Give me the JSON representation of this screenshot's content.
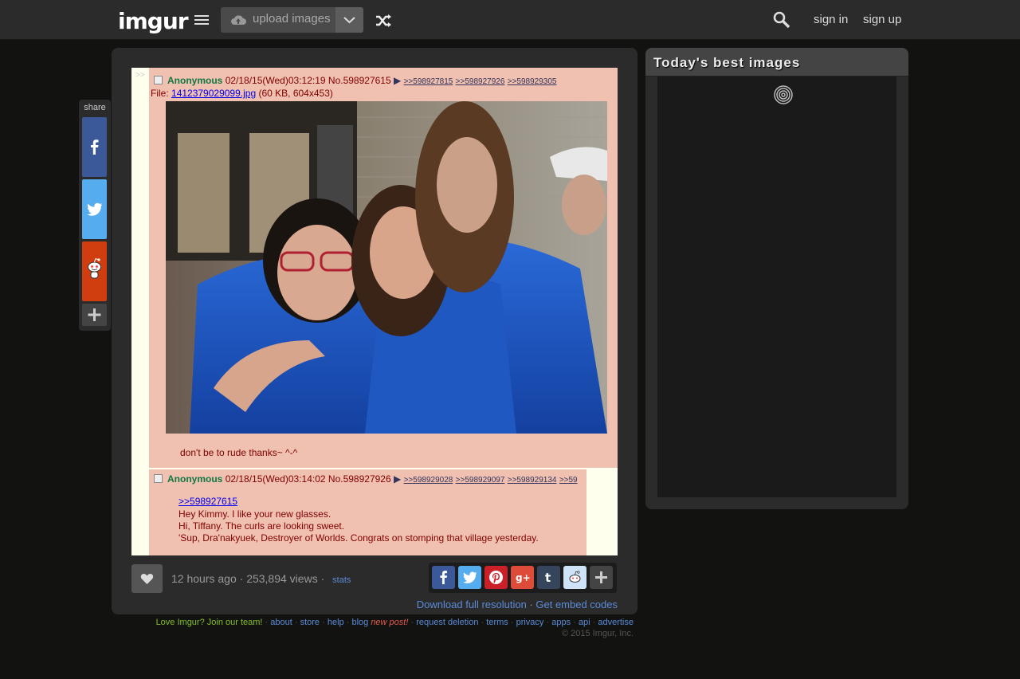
{
  "header": {
    "logo": "imgur",
    "upload_label": "upload images",
    "sign_in": "sign in",
    "sign_up": "sign up",
    "icons": [
      "menu-icon",
      "cloud-upload-icon",
      "chevron-down-icon",
      "shuffle-icon",
      "search-icon"
    ]
  },
  "share_sidebar": {
    "title": "share",
    "buttons": [
      {
        "name": "facebook",
        "color": "#3b5998"
      },
      {
        "name": "twitter",
        "color": "#55acee"
      },
      {
        "name": "reddit",
        "color": "#d03e0f"
      }
    ]
  },
  "post_image": {
    "post1": {
      "marker": ">>",
      "name": "Anonymous",
      "datetime": "02/18/15(Wed)03:12:19",
      "number": "No.598927615",
      "replies": [
        ">>598927815",
        ">>598927926",
        ">>598929305"
      ],
      "file_label": "File:",
      "file_name": "1412379029099.jpg",
      "file_info": "(60 KB, 604x453)",
      "comment": "don't be to rude thanks~ ^-^"
    },
    "post2": {
      "name": "Anonymous",
      "datetime": "02/18/15(Wed)03:14:02",
      "number": "No.598927926",
      "replies": [
        ">>598929028",
        ">>598929097",
        ">>598929134",
        ">>59"
      ],
      "quote": ">>598927615",
      "lines": [
        "Hey Kimmy. I like your new glasses.",
        "Hi, Tiffany. The curls are looking sweet.",
        "'Sup, Dra'nakyuek, Destroyer of Worlds. Congrats on stomping that village yesterday."
      ]
    }
  },
  "meta": {
    "time": "12 hours ago",
    "views": "253,894 views",
    "stats": "stats",
    "download": "Download full resolution",
    "embed": "Get embed codes",
    "share_icons": [
      "facebook",
      "twitter",
      "pinterest",
      "google-plus",
      "tumblr",
      "reddit",
      "more"
    ]
  },
  "best": {
    "title": "Today's best images"
  },
  "footer": {
    "join": "Love Imgur? Join our team!",
    "links": [
      "about",
      "store",
      "help",
      "blog"
    ],
    "new_post": "new post!",
    "links2": [
      "request deletion",
      "terms",
      "privacy",
      "apps",
      "api",
      "advertise"
    ],
    "copyright": "© 2015 Imgur, Inc."
  },
  "colors": {
    "background": "#121211",
    "panel": "#2b2b2b",
    "link": "#5b8bd7",
    "chan_post": "#f0c0b0",
    "chan_name": "#117743"
  }
}
